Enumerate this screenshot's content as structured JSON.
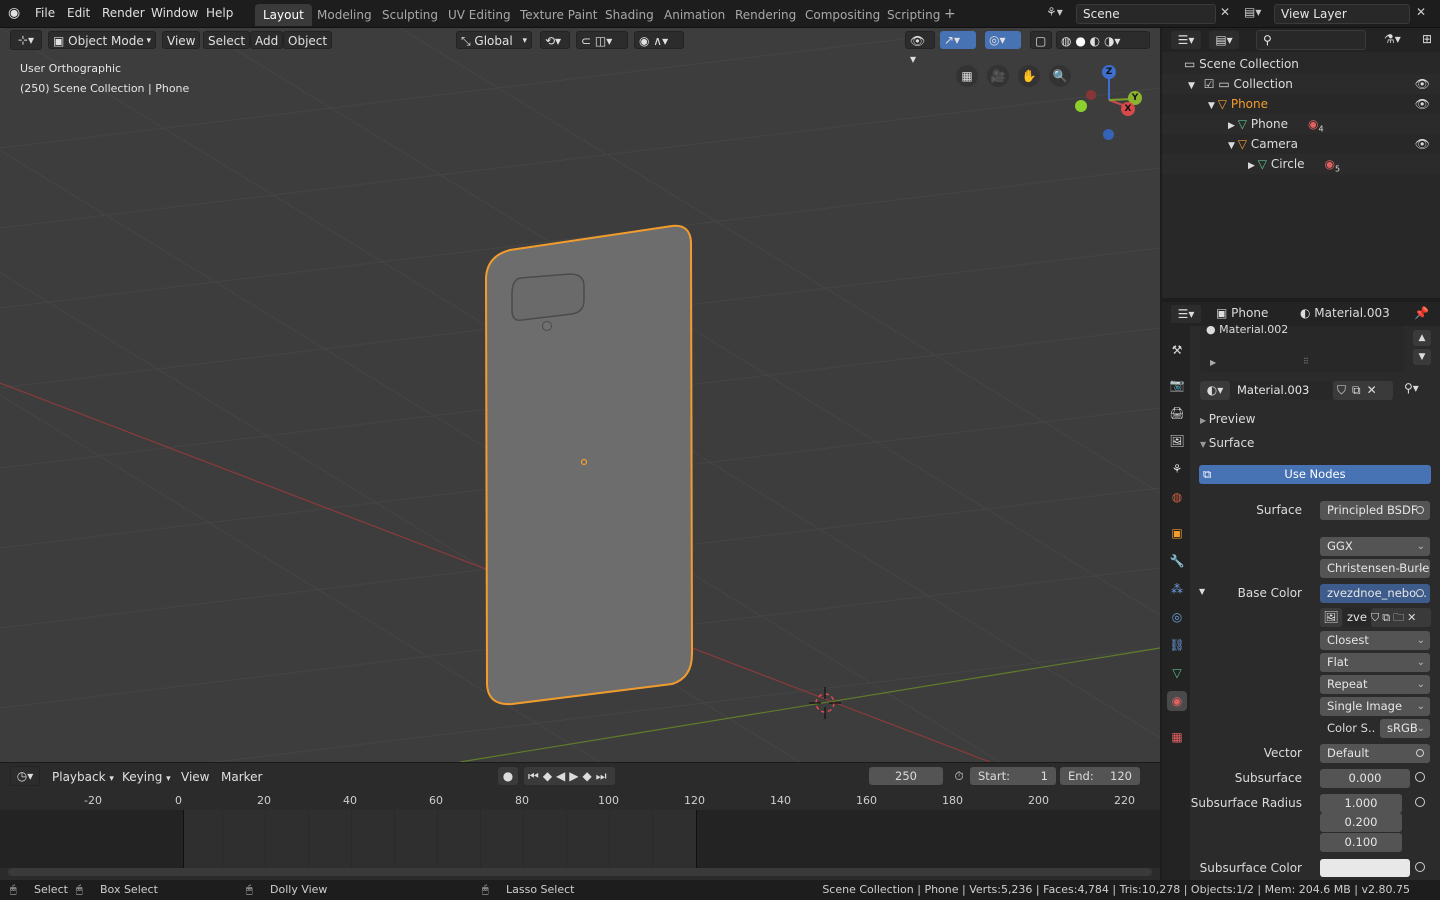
{
  "menu": [
    "File",
    "Edit",
    "Render",
    "Window",
    "Help"
  ],
  "workspaces": [
    "Layout",
    "Modeling",
    "Sculpting",
    "UV Editing",
    "Texture Paint",
    "Shading",
    "Animation",
    "Rendering",
    "Compositing",
    "Scripting"
  ],
  "scene": {
    "name": "Scene",
    "view_layer": "View Layer"
  },
  "viewport_header": {
    "mode": "Object Mode",
    "view": "View",
    "select": "Select",
    "add": "Add",
    "object": "Object",
    "orientation": "Global"
  },
  "viewport": {
    "view_name": "User Orthographic",
    "context": "(250) Scene Collection | Phone"
  },
  "timeline": {
    "playback": "Playback",
    "keying": "Keying",
    "view": "View",
    "marker": "Marker",
    "current": "250",
    "start_label": "Start:",
    "start": "1",
    "end_label": "End:",
    "end": "120",
    "ruler": [
      "-20",
      "0",
      "20",
      "40",
      "60",
      "80",
      "100",
      "120",
      "140",
      "160",
      "180",
      "200",
      "220"
    ]
  },
  "status": {
    "select": "Select",
    "box_select": "Box Select",
    "dolly": "Dolly View",
    "lasso": "Lasso Select",
    "info": "Scene Collection | Phone | Verts:5,236 | Faces:4,784 | Tris:10,278 | Objects:1/2 | Mem: 204.6 MB | v2.80.75"
  },
  "outliner": {
    "root": "Scene Collection",
    "items": [
      {
        "label": "Collection"
      },
      {
        "label": "Phone"
      },
      {
        "label": "Phone",
        "badge": "4"
      },
      {
        "label": "Camera"
      },
      {
        "label": "Circle",
        "badge": "5"
      }
    ]
  },
  "properties": {
    "object": "Phone",
    "material": "Material.003",
    "slot_item": "Material.002",
    "material_field": "Material.003",
    "preview": "Preview",
    "surface_panel": "Surface",
    "use_nodes": "Use Nodes",
    "surface_label": "Surface",
    "surface_value": "Principled BSDF",
    "distribution": "GGX",
    "subsurface_method": "Christensen-Burle",
    "base_color_label": "Base Color",
    "base_color_value": "zvezdnoe_nebo...",
    "image_name": "zve",
    "interpolation": "Closest",
    "projection": "Flat",
    "extension": "Repeat",
    "source": "Single Image",
    "color_space_label": "Color S..",
    "color_space": "sRGB",
    "vector_label": "Vector",
    "vector_value": "Default",
    "subsurface_label": "Subsurface",
    "subsurface_value": "0.000",
    "ss_radius_label": "Subsurface Radius",
    "ss_radius": [
      "1.000",
      "0.200",
      "0.100"
    ],
    "ss_color_label": "Subsurface Color"
  },
  "colors": {
    "accent": "#4772b3",
    "selection": "#f39c2e",
    "viewport_bg": "#3d3d3d",
    "x_axis": "#9b3b3b",
    "y_axis": "#6b8b2a"
  }
}
